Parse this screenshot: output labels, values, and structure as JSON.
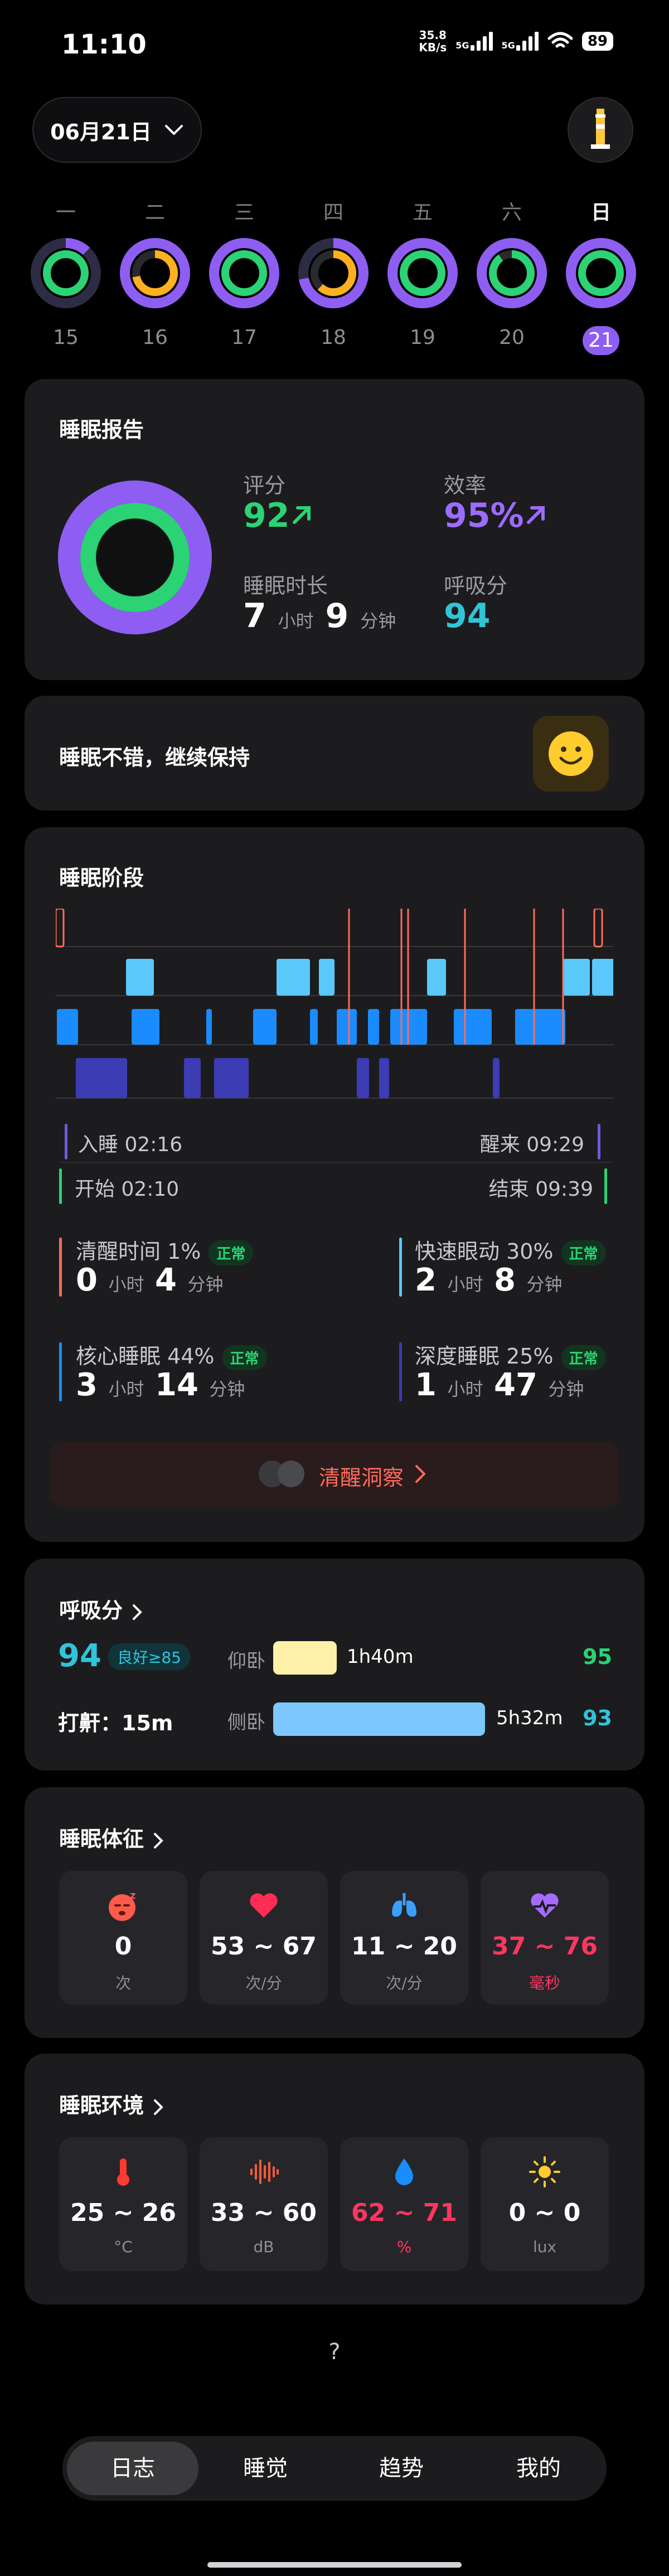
{
  "status": {
    "time": "11:10",
    "net_speed": "35.8",
    "net_unit": "KB/s",
    "net1": "5G",
    "net2": "5G",
    "battery": "89"
  },
  "header": {
    "date": "06月21日"
  },
  "week": {
    "labels": [
      "一",
      "二",
      "三",
      "四",
      "五",
      "六",
      "日"
    ],
    "dates": [
      "15",
      "16",
      "17",
      "18",
      "19",
      "20",
      "21"
    ],
    "selected_index": 6
  },
  "report": {
    "title": "睡眠报告",
    "score_label": "评分",
    "score": "92",
    "efficiency_label": "效率",
    "efficiency": "95%",
    "duration_label": "睡眠时长",
    "duration_h": "7",
    "duration_h_unit": "小时",
    "duration_m": "9",
    "duration_m_unit": "分钟",
    "breath_label": "呼吸分",
    "breath": "94"
  },
  "message": {
    "text": "睡眠不错，继续保持"
  },
  "stages": {
    "title": "睡眠阶段",
    "asleep": "入睡 02:16",
    "wake": "醒来 09:29",
    "start": "开始 02:10",
    "end": "结束 09:39",
    "awake_label": "清醒时间 1%",
    "awake_h": "0",
    "awake_m": "4",
    "rem_label": "快速眼动 30%",
    "rem_h": "2",
    "rem_m": "8",
    "core_label": "核心睡眠 44%",
    "core_h": "3",
    "core_m": "14",
    "deep_label": "深度睡眠 25%",
    "deep_h": "1",
    "deep_m": "47",
    "unit_h": "小时",
    "unit_m": "分钟",
    "normal": "正常",
    "insight": "清醒洞察",
    "colors": {
      "awake": "#ff6b5a",
      "rem": "#5ac8fa",
      "core": "#1a8cff",
      "deep": "#3c3cb4"
    }
  },
  "breath": {
    "title": "呼吸分",
    "score": "94",
    "badge": "良好≥85",
    "supine_label": "仰卧",
    "supine_time": "1h40m",
    "supine_score": "95",
    "snore_label": "打鼾：15m",
    "side_label": "侧卧",
    "side_time": "5h32m",
    "side_score": "93",
    "supine_fraction": 0.23,
    "side_fraction": 0.77
  },
  "vitals": {
    "title": "睡眠体征",
    "items": [
      {
        "icon": "sleep-face-icon",
        "value": "0",
        "unit": "次",
        "color": "#ffffff"
      },
      {
        "icon": "heart-icon",
        "value": "53 ~ 67",
        "unit": "次/分",
        "color": "#ffffff"
      },
      {
        "icon": "lungs-icon",
        "value": "11 ~ 20",
        "unit": "次/分",
        "color": "#ffffff"
      },
      {
        "icon": "heart-rate-icon",
        "value": "37 ~ 76",
        "unit": "毫秒",
        "color": "#ff375f"
      }
    ]
  },
  "environment": {
    "title": "睡眠环境",
    "items": [
      {
        "icon": "thermometer-icon",
        "value": "25 ~ 26",
        "unit": "°C",
        "color": "#ffffff"
      },
      {
        "icon": "sound-wave-icon",
        "value": "33 ~ 60",
        "unit": "dB",
        "color": "#ffffff"
      },
      {
        "icon": "drop-icon",
        "value": "62 ~ 71",
        "unit": "%",
        "color": "#ff375f"
      },
      {
        "icon": "sun-icon",
        "value": "0 ~ 0",
        "unit": "lux",
        "color": "#ffffff"
      }
    ]
  },
  "help": "?",
  "nav": [
    "日志",
    "睡觉",
    "趋势",
    "我的"
  ]
}
